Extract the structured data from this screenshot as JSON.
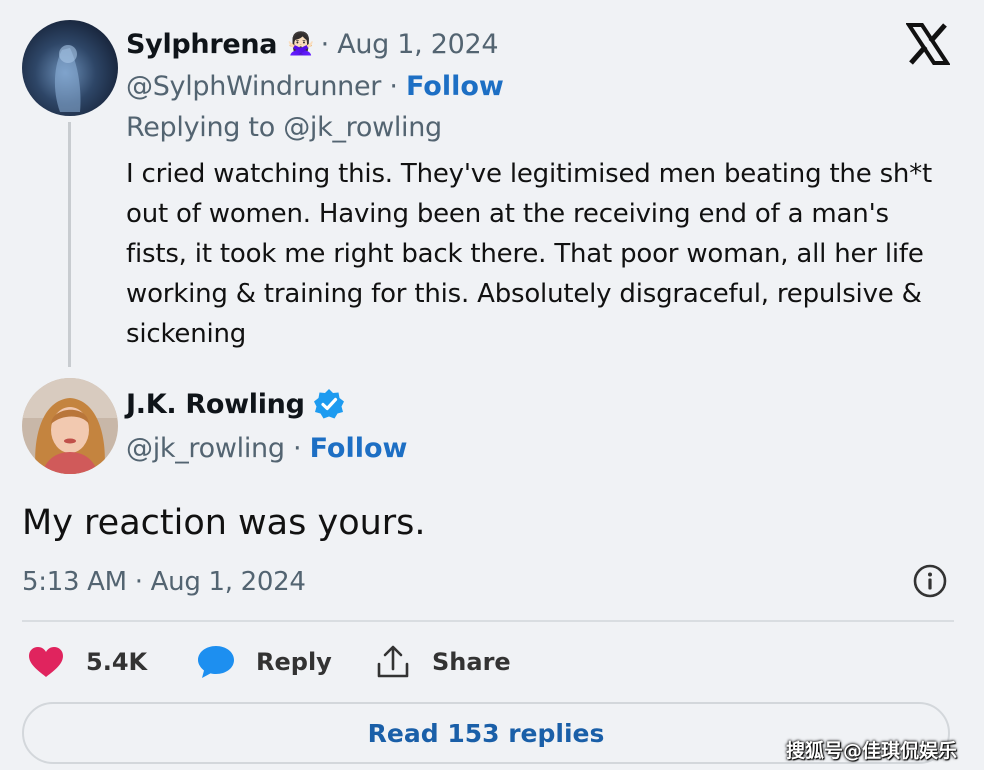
{
  "reply_tweet": {
    "name": "Sylphrena",
    "name_emoji": "🙅🏻‍♀️",
    "date": "· Aug 1, 2024",
    "handle": "@SylphWindrunner",
    "follow_sep": " · ",
    "follow_label": "Follow",
    "replying_to": "Replying to @jk_rowling",
    "text": "I cried watching this. They've legitimised men beating the sh*t out of women. Having been at the receiving end of a man's fists, it took me right back there. That poor woman, all her life working & training for this. Absolutely disgraceful, repulsive & sickening"
  },
  "main_tweet": {
    "name": "J.K. Rowling",
    "handle": "@jk_rowling",
    "follow_sep": " · ",
    "follow_label": "Follow",
    "text": "My reaction was yours.",
    "timestamp": "5:13 AM · Aug 1, 2024"
  },
  "actions": {
    "likes": "5.4K",
    "reply_label": "Reply",
    "share_label": "Share"
  },
  "read_replies_label": "Read 153 replies",
  "watermark": "搜狐号@佳琪侃娱乐",
  "colors": {
    "accent": "#1d6fc4",
    "like": "#e0245e",
    "reply_icon": "#1d8ff0"
  }
}
